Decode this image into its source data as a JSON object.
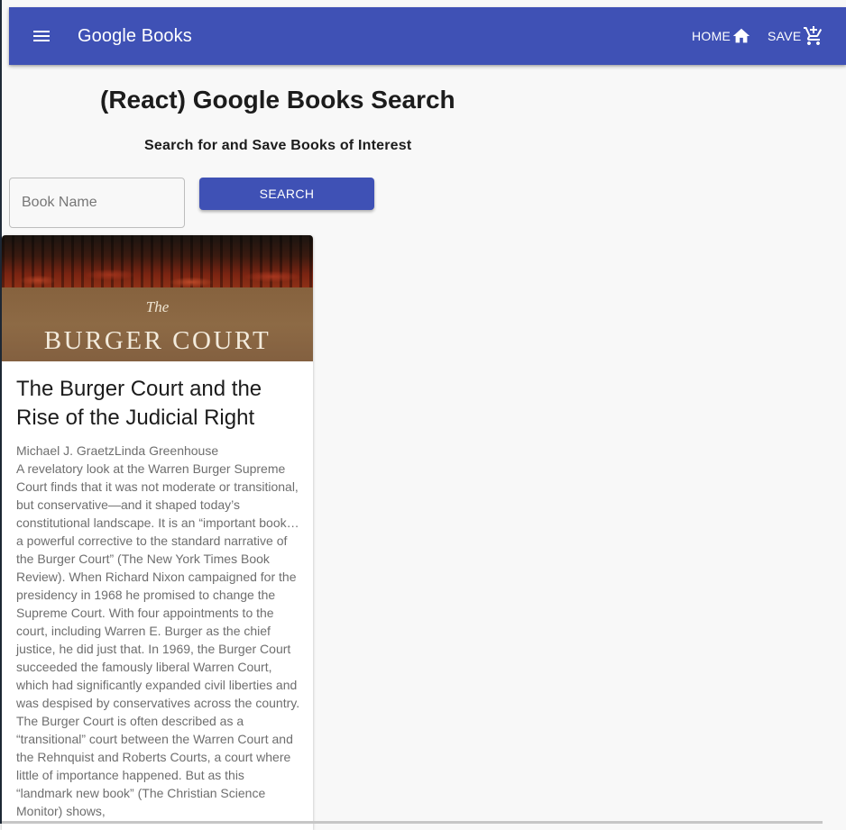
{
  "appbar": {
    "title": "Google Books",
    "menu_icon": "hamburger-menu-icon",
    "home_label": "HOME",
    "home_icon": "home-icon",
    "save_label": "SAVE",
    "save_icon": "add-shopping-cart-icon"
  },
  "header": {
    "title": "(React) Google Books Search",
    "subtitle": "Search for and Save Books of Interest"
  },
  "search": {
    "placeholder": "Book Name",
    "value": "",
    "button_label": "SEARCH"
  },
  "results": [
    {
      "cover_text_small": "The",
      "cover_text_large": "BURGER COURT",
      "title": "The Burger Court and the Rise of the Judicial Right",
      "authors": "Michael J. GraetzLinda Greenhouse",
      "description": "A revelatory look at the Warren Burger Supreme Court finds that it was not moderate or transitional, but conservative—and it shaped today’s constitutional landscape. It is an “important book…a powerful corrective to the standard narrative of the Burger Court” (The New York Times Book Review). When Richard Nixon campaigned for the presidency in 1968 he promised to change the Supreme Court. With four appointments to the court, including Warren E. Burger as the chief justice, he did just that. In 1969, the Burger Court succeeded the famously liberal Warren Court, which had significantly expanded civil liberties and was despised by conservatives across the country. The Burger Court is often described as a “transitional” court between the Warren Court and the Rehnquist and Roberts Courts, a court where little of importance happened. But as this “landmark new book” (The Christian Science Monitor) shows,"
    }
  ],
  "colors": {
    "primary": "#3f51b5",
    "background": "#f8f8f8",
    "card": "#ffffff",
    "secondary_text": "#6e6e6e"
  }
}
